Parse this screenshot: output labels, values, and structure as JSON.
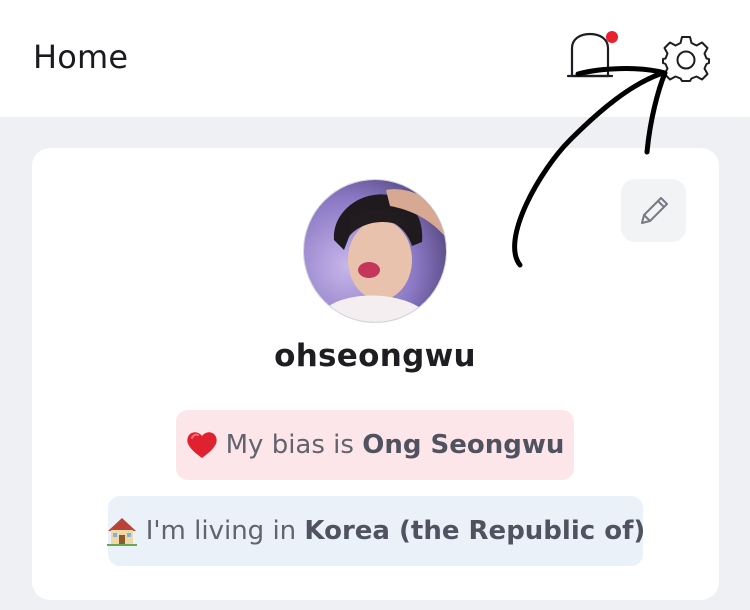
{
  "header": {
    "title": "Home",
    "notification_icon": "bell-icon",
    "settings_icon": "gear-icon",
    "notification_dot_color": "#e8202f"
  },
  "profile": {
    "avatar_icon": "avatar",
    "username": "ohseongwu",
    "edit_icon": "pencil-icon",
    "bias": {
      "emoji_icon": "heart-icon",
      "prefix": "My bias is",
      "value": "Ong Seongwu",
      "background": "#fde6ea"
    },
    "location": {
      "emoji_icon": "house-icon",
      "prefix": "I'm living in",
      "value": "Korea (the Republic of)",
      "background": "#ebf1f9"
    }
  },
  "annotation": {
    "type": "hand-drawn arrow pointing to settings"
  }
}
